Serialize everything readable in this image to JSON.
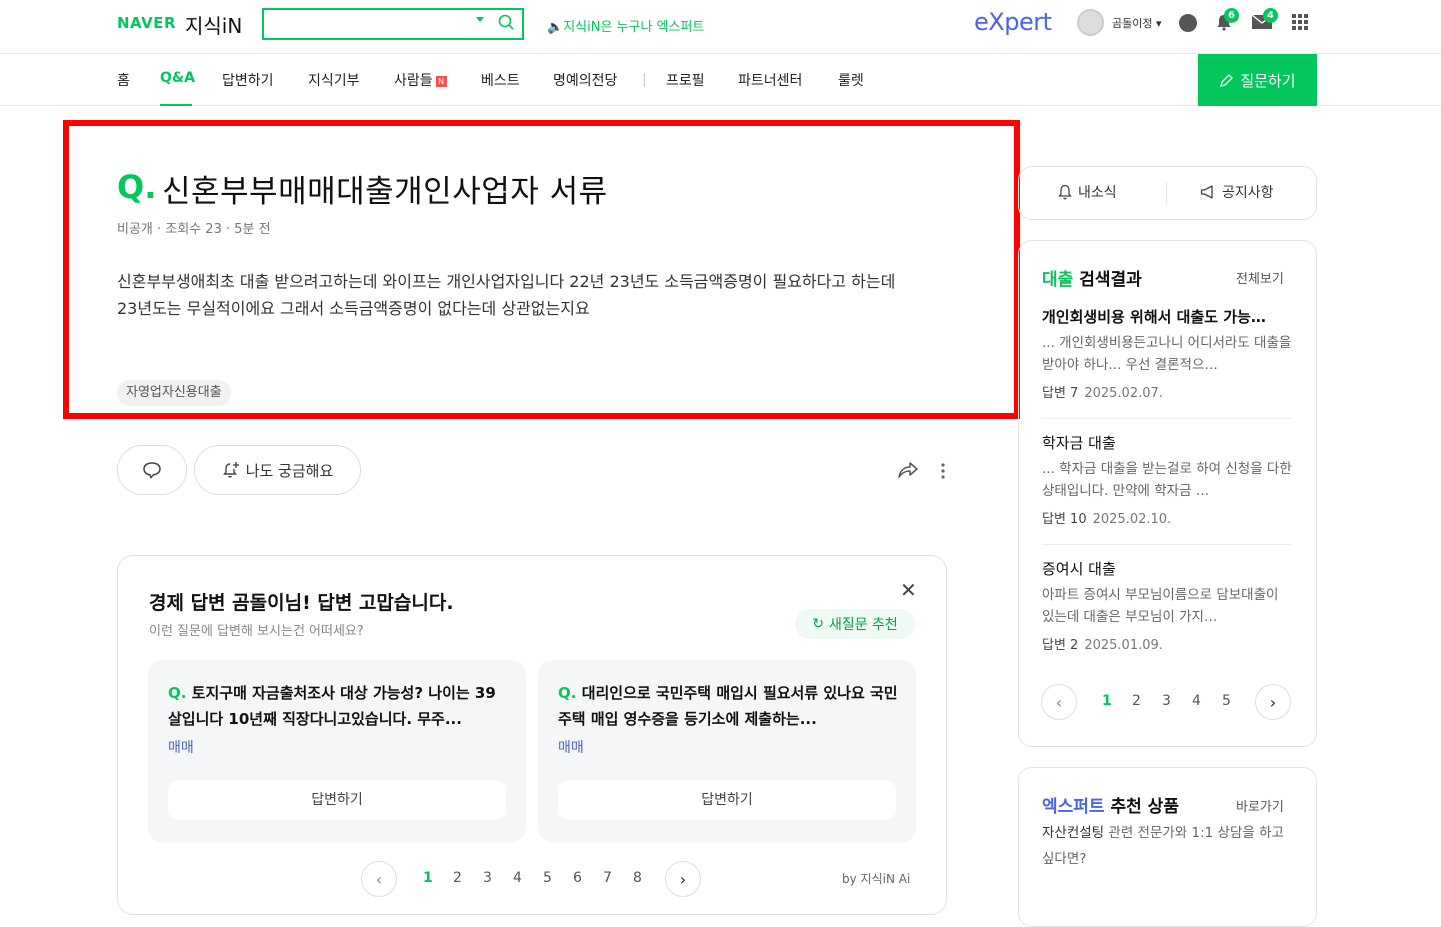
{
  "header": {
    "logo_naver": "NAVER",
    "logo_kin": "지식iN",
    "search_value": "",
    "promo": "지식iN은 누구나 엑스퍼트",
    "expert_logo": "eXpert",
    "user_name": "곰돌이정",
    "bell_count": "6",
    "mail_count": "4"
  },
  "nav": {
    "items": [
      "홈",
      "Q&A",
      "답변하기",
      "지식기부",
      "사람들",
      "베스트",
      "명예의전당",
      "프로필",
      "파트너센터",
      "룰렛"
    ],
    "new_badge": "N",
    "ask_button": "질문하기"
  },
  "question": {
    "q_mark": "Q.",
    "title": "신혼부부매매대출개인사업자 서류",
    "author": "비공개",
    "views": "조회수 23",
    "time": "5분 전",
    "body_line1": "신혼부부생애최초 대출 받으려고하는데 와이프는 개인사업자입니다 22년 23년도 소득금액증명이 필요하다고 하는데",
    "body_line2": "23년도는 무실적이에요 그래서 소득금액증명이 없다는데 상관없는지요",
    "tag": "자영업자신용대출"
  },
  "actions": {
    "curious": "나도 궁금해요"
  },
  "recommend": {
    "title": "경제 답변 곰돌이님! 답변 고맙습니다.",
    "subtitle": "이런 질문에 답변해 보시는건 어떠세요?",
    "refresh": "새질문 추천",
    "cards": [
      {
        "q": "Q.",
        "text": "토지구매 자금출처조사 대상 가능성? 나이는 39살입니다 10년째 직장다니고있습니다. 무주...",
        "category": "매매",
        "button": "답변하기"
      },
      {
        "q": "Q.",
        "text": "대리인으로 국민주택 매입시 필요서류 있나요 국민주택 매입 영수증을 등기소에 제출하는...",
        "category": "매매",
        "button": "답변하기"
      }
    ],
    "pages": [
      "1",
      "2",
      "3",
      "4",
      "5",
      "6",
      "7",
      "8"
    ],
    "by": "by 지식iN Ai"
  },
  "sidebar": {
    "news": "내소식",
    "announce": "공지사항",
    "search_result": {
      "keyword": "대출",
      "title_suffix": " 검색결과",
      "view_all": "전체보기",
      "items": [
        {
          "title": "개인회생비용 위해서 대출도 가능…",
          "snippet": "... 개인회생비용든고나니 어디서라도 대출을 받아야 하나... 우선 결론적으…",
          "answers": "답변 7",
          "date": "2025.02.07."
        },
        {
          "title": "학자금 대출",
          "snippet": "... 학자금 대출을 받는걸로 하여 신청을 다한 상태입니다. 만약에 학자금 …",
          "answers": "답변 10",
          "date": "2025.02.10."
        },
        {
          "title": "증여시 대출",
          "snippet": "아파트 증여시 부모님이름으로 담보대출이 있는데 대출은 부모님이 가지…",
          "answers": "답변 2",
          "date": "2025.01.09."
        }
      ],
      "pages": [
        "1",
        "2",
        "3",
        "4",
        "5"
      ]
    },
    "expert": {
      "keyword": "엑스퍼트",
      "title_suffix": " 추천 상품",
      "go": "바로가기",
      "desc_bold": "자산컨설팅",
      "desc_rest": " 관련 전문가와 1:1 상담을 하고 싶다면?"
    }
  }
}
